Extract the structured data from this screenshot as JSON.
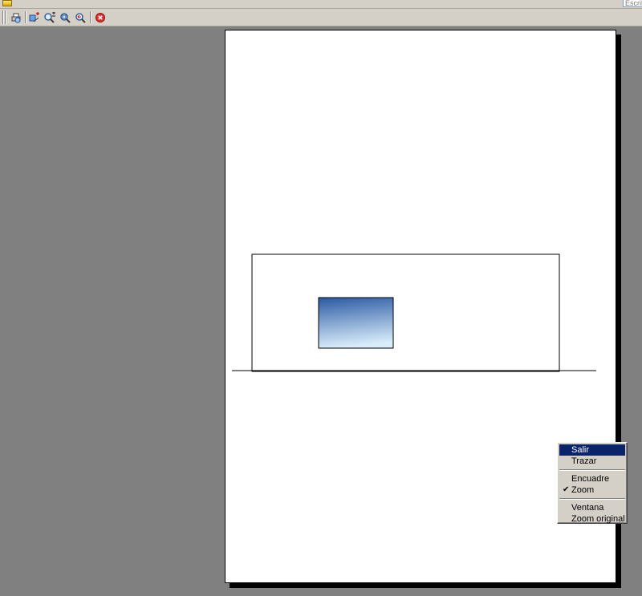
{
  "search": {
    "placeholder": "Escrib"
  },
  "toolbar": {
    "buttons": [
      {
        "icon": "print-preview-icon"
      },
      {
        "icon": "add-to-selection-icon"
      },
      {
        "icon": "zoom-in-out-icon"
      },
      {
        "icon": "zoom-window-icon"
      },
      {
        "icon": "zoom-previous-icon"
      },
      {
        "icon": "close-icon"
      }
    ]
  },
  "context_menu": {
    "items": [
      {
        "label": "Salir",
        "highlighted": true
      },
      {
        "label": "Trazar"
      },
      {
        "label": "Encuadre"
      },
      {
        "label": "Zoom",
        "checked": true
      },
      {
        "label": "Ventana"
      },
      {
        "label": "Zoom original"
      }
    ]
  },
  "colors": {
    "workspace": "#808080",
    "chrome": "#d4d0c8",
    "menu_highlight": "#0a246a",
    "fill_gradient_top": "#2b5aa3",
    "fill_gradient_bottom": "#d8ecfa"
  }
}
